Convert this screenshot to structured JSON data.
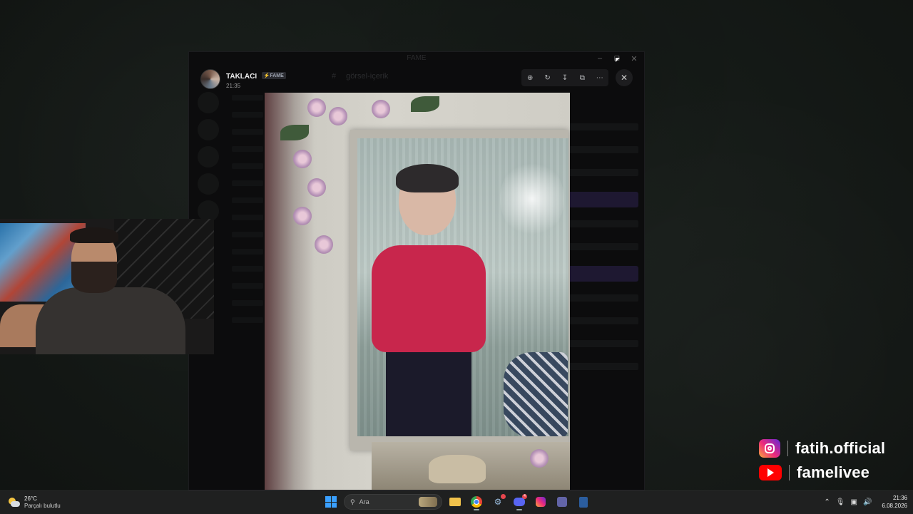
{
  "window": {
    "title": "FAME",
    "controls": [
      "minimize-icon",
      "maximize-icon",
      "close-icon"
    ]
  },
  "dim_topbar": {
    "channel": "görsel-içerik"
  },
  "viewer": {
    "user_name": "TAKLACI",
    "user_tag": "FAME",
    "time": "21:35",
    "tools": [
      "zoom-in-icon",
      "rotate-icon",
      "download-icon",
      "open-external-icon",
      "more-icon"
    ],
    "close_icon": "close-icon"
  },
  "social": {
    "instagram": "fatih.official",
    "youtube": "famelivee"
  },
  "taskbar": {
    "weather_temp": "26°C",
    "weather_desc": "Parçalı bulutlu",
    "search_placeholder": "Ara",
    "discord_badge": "4",
    "time": "21:36",
    "date": "6.08.2026"
  }
}
